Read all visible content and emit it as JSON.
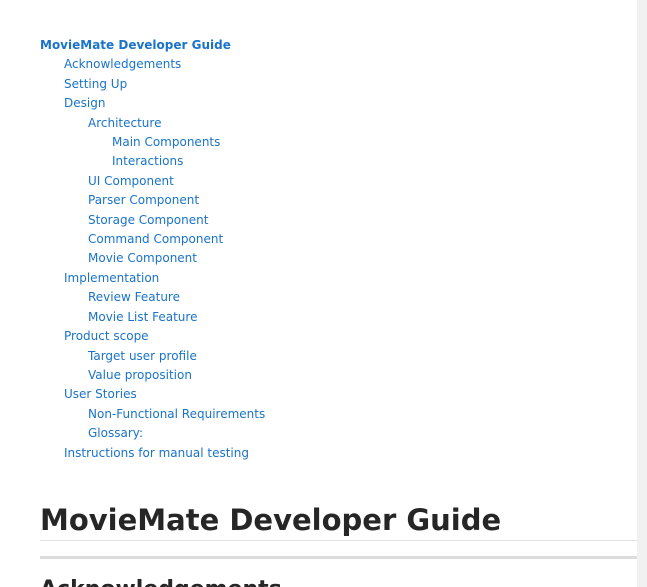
{
  "toc": {
    "items": [
      {
        "label": "MovieMate Developer Guide",
        "level": 0
      },
      {
        "label": "Acknowledgements",
        "level": 1
      },
      {
        "label": "Setting Up",
        "level": 1
      },
      {
        "label": "Design",
        "level": 1
      },
      {
        "label": "Architecture",
        "level": 2
      },
      {
        "label": "Main Components",
        "level": 3
      },
      {
        "label": "Interactions",
        "level": 3
      },
      {
        "label": "UI Component",
        "level": 2
      },
      {
        "label": "Parser Component",
        "level": 2
      },
      {
        "label": "Storage Component",
        "level": 2
      },
      {
        "label": "Command Component",
        "level": 2
      },
      {
        "label": "Movie Component",
        "level": 2
      },
      {
        "label": "Implementation",
        "level": 1
      },
      {
        "label": "Review Feature",
        "level": 2
      },
      {
        "label": "Movie List Feature",
        "level": 2
      },
      {
        "label": "Product scope",
        "level": 1
      },
      {
        "label": "Target user profile",
        "level": 2
      },
      {
        "label": "Value proposition",
        "level": 2
      },
      {
        "label": "User Stories",
        "level": 1
      },
      {
        "label": "Non-Functional Requirements",
        "level": 2
      },
      {
        "label": "Glossary:",
        "level": 2
      },
      {
        "label": "Instructions for manual testing",
        "level": 1
      }
    ]
  },
  "document": {
    "title": "MovieMate Developer Guide",
    "first_section": "Acknowledgements"
  }
}
